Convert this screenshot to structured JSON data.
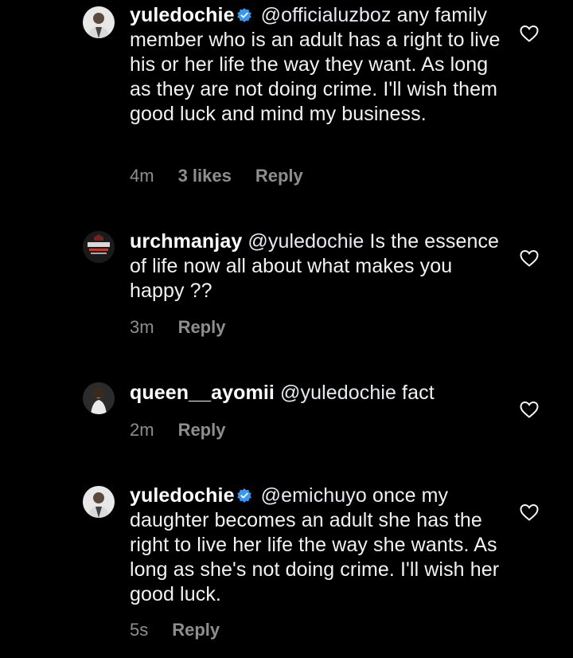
{
  "comments": [
    {
      "username": "yuledochie",
      "verified": true,
      "mention": "@officialuzboz",
      "text": "any family member who is an adult has a right to live his or her life the way they want. As long as they are not doing crime. I'll wish them good luck and mind my business.",
      "time": "4m",
      "likes": "3 likes",
      "reply": "Reply"
    },
    {
      "username": "urchmanjay",
      "verified": false,
      "mention": "@yuledochie",
      "text": "Is the essence of life now all about what makes you happy ??",
      "time": "3m",
      "reply": "Reply"
    },
    {
      "username": "queen__ayomii",
      "verified": false,
      "mention": "@yuledochie",
      "text": "fact",
      "time": "2m",
      "reply": "Reply"
    },
    {
      "username": "yuledochie",
      "verified": true,
      "mention": "@emichuyo",
      "text": "once my daughter becomes an adult she has the right to live her life the way she wants. As long as she's not doing crime. I'll wish her good luck.",
      "time": "5s",
      "reply": "Reply"
    }
  ],
  "icons": {
    "verified": "verified-badge-icon",
    "like": "heart-outline-icon"
  },
  "colors": {
    "background": "#000000",
    "text": "#f2f2f2",
    "meta": "#8e8e8e",
    "verified": "#3897f0"
  }
}
